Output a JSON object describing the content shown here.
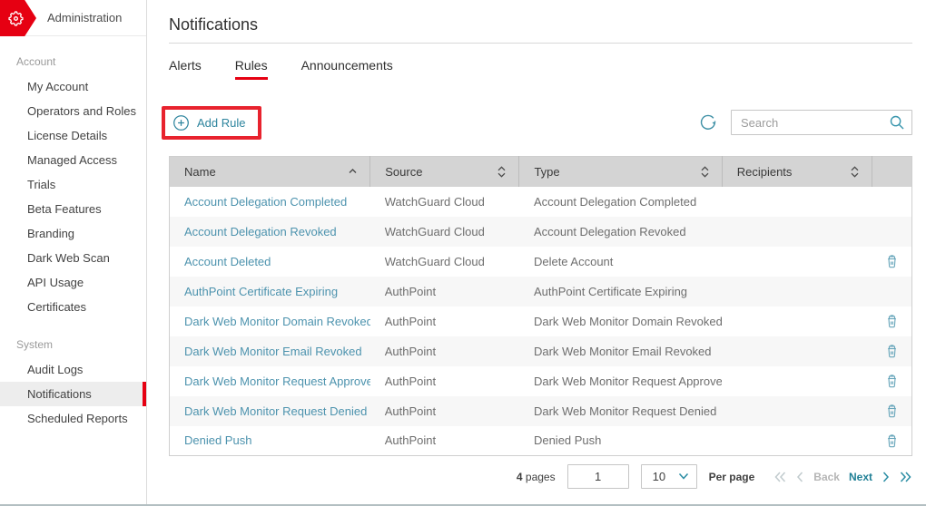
{
  "colors": {
    "brand_red": "#e60012",
    "annotation_red": "#e8232e",
    "accent_teal": "#2e859e",
    "link_teal": "#4d93ae",
    "icon_teal": "#68a6bb",
    "selected_item_bg": "#ededed",
    "table_header_bg": "#d4d4d4",
    "row_alt_bg": "#f7f7f7"
  },
  "icons": {
    "gear": "⚙",
    "plus-circle": "⊕",
    "refresh": "⟳",
    "search": "🔍",
    "trash": "🗑",
    "sort-asc": "⌃",
    "sort-both": "⇅",
    "chevron-down": "⌄",
    "chevron-left": "‹",
    "chevron-right": "›",
    "double-chevron-left": "«",
    "double-chevron-right": "»"
  },
  "header": {
    "app_label": "Administration"
  },
  "sidebar": {
    "sections": [
      {
        "label": "Account",
        "items": [
          "My Account",
          "Operators and Roles",
          "License Details",
          "Managed Access",
          "Trials",
          "Beta Features",
          "Branding",
          "Dark Web Scan",
          "API Usage",
          "Certificates"
        ],
        "selected": ""
      },
      {
        "label": "System",
        "items": [
          "Audit Logs",
          "Notifications",
          "Scheduled Reports"
        ],
        "selected": "Notifications"
      }
    ]
  },
  "main": {
    "title": "Notifications",
    "tabs": [
      "Alerts",
      "Rules",
      "Announcements"
    ],
    "active_tab": "Rules",
    "toolbar": {
      "add_rule_label": "Add Rule",
      "search_placeholder": "Search"
    },
    "table": {
      "columns": [
        "Name",
        "Source",
        "Type",
        "Recipients"
      ],
      "sort": {
        "Name": "asc",
        "Source": "both",
        "Type": "both",
        "Recipients": "both"
      },
      "rows": [
        {
          "name": "Account Delegation Completed",
          "source": "WatchGuard Cloud",
          "type": "Account Delegation Completed",
          "recipients": "",
          "deletable": false
        },
        {
          "name": "Account Delegation Revoked",
          "source": "WatchGuard Cloud",
          "type": "Account Delegation Revoked",
          "recipients": "",
          "deletable": false
        },
        {
          "name": "Account Deleted",
          "source": "WatchGuard Cloud",
          "type": "Delete Account",
          "recipients": "",
          "deletable": true
        },
        {
          "name": "AuthPoint Certificate Expiring",
          "source": "AuthPoint",
          "type": "AuthPoint Certificate Expiring",
          "recipients": "",
          "deletable": false
        },
        {
          "name": "Dark Web Monitor Domain Revoked",
          "source": "AuthPoint",
          "type": "Dark Web Monitor Domain Revoked",
          "recipients": "",
          "deletable": true
        },
        {
          "name": "Dark Web Monitor Email Revoked",
          "source": "AuthPoint",
          "type": "Dark Web Monitor Email Revoked",
          "recipients": "",
          "deletable": true
        },
        {
          "name": "Dark Web Monitor Request Approved",
          "source": "AuthPoint",
          "type": "Dark Web Monitor Request Approved",
          "recipients": "",
          "deletable": true
        },
        {
          "name": "Dark Web Monitor Request Denied",
          "source": "AuthPoint",
          "type": "Dark Web Monitor Request Denied",
          "recipients": "",
          "deletable": true
        },
        {
          "name": "Denied Push",
          "source": "AuthPoint",
          "type": "Denied Push",
          "recipients": "",
          "deletable": true
        }
      ]
    },
    "pagination": {
      "pages_count": "4",
      "pages_word": "pages",
      "current_page": "1",
      "per_page_value": "10",
      "per_page_label": "Per page",
      "back_label": "Back",
      "next_label": "Next"
    }
  }
}
